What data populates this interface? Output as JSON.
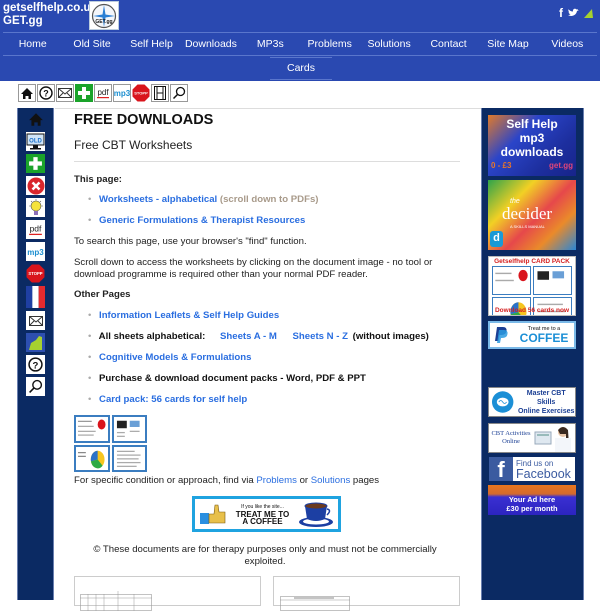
{
  "header": {
    "site_name": "getselfhelp.co.uk",
    "site_short": "GET.gg",
    "logo_text": "GET.gg",
    "social": [
      {
        "name": "facebook",
        "glyph": "f"
      },
      {
        "name": "twitter",
        "glyph": "🐦"
      },
      {
        "name": "getgg",
        "glyph": "▲"
      }
    ],
    "nav": [
      "Home",
      "Old Site",
      "Self Help",
      "Downloads",
      "MP3s",
      "Problems",
      "Solutions",
      "Contact",
      "Site Map",
      "Videos"
    ],
    "nav_row2": [
      "Cards"
    ]
  },
  "toolbar": [
    {
      "name": "home-icon",
      "glyph": "⌂"
    },
    {
      "name": "help-icon",
      "glyph": "?"
    },
    {
      "name": "mail-icon",
      "glyph": "✉"
    },
    {
      "name": "first-aid-icon",
      "glyph": "+"
    },
    {
      "name": "pdf-icon",
      "glyph": "pdf"
    },
    {
      "name": "mp3-icon",
      "glyph": "mp3"
    },
    {
      "name": "stop-icon",
      "glyph": "STOPP"
    },
    {
      "name": "film-icon",
      "glyph": "▥"
    },
    {
      "name": "search-icon",
      "glyph": "⚲"
    }
  ],
  "left_sidebar": [
    {
      "name": "home-icon",
      "glyph": "⌂"
    },
    {
      "name": "old-site-icon",
      "glyph": "OLD"
    },
    {
      "name": "first-aid-icon",
      "glyph": "+"
    },
    {
      "name": "close-icon",
      "glyph": "✕"
    },
    {
      "name": "lightbulb-icon",
      "glyph": "💡"
    },
    {
      "name": "pdf-icon",
      "glyph": "pdf"
    },
    {
      "name": "mp3-icon",
      "glyph": "mp3"
    },
    {
      "name": "stop-icon",
      "glyph": "STOPP"
    },
    {
      "name": "french-flag-icon",
      "glyph": ""
    },
    {
      "name": "mail-icon",
      "glyph": "✉"
    },
    {
      "name": "getgg-icon",
      "glyph": "▲"
    },
    {
      "name": "help-icon",
      "glyph": "?"
    },
    {
      "name": "search-icon",
      "glyph": "⚲"
    }
  ],
  "main": {
    "title": "FREE DOWNLOADS",
    "subtitle": "Free CBT Worksheets",
    "this_page_label": "This page:",
    "this_page_links": [
      {
        "text": "Worksheets - alphabetical",
        "note": "(scroll down to PDFs)"
      },
      {
        "text": "Generic Formulations & Therapist Resources"
      }
    ],
    "search_tip": "To search this page, use your browser's \"find\" function.",
    "scroll_tip": "Scroll down to access the worksheets by clicking on the document image - no tool or download programme is required other than your normal PDF reader.",
    "other_pages_label": "Other Pages",
    "other_pages": {
      "info_leaflets": "Information Leaflets & Self Help Guides",
      "all_sheets_label": "All sheets alphabetical:",
      "sheets_a_m": "Sheets A - M",
      "sheets_n_z": "Sheets N - Z",
      "without_images": "(without images)",
      "cognitive_models": "Cognitive Models & Formulations",
      "purchase": "Purchase & download document packs - Word, PDF & PPT",
      "card_pack": "Card pack: 56 cards for self help"
    },
    "find_via": {
      "prefix": "For specific condition or approach, find via ",
      "problems": "Problems",
      "middle": " or ",
      "solutions": "Solutions",
      "suffix": " pages"
    },
    "coffee_banner": {
      "small": "If you like the site...",
      "line1": "TREAT ME TO",
      "line2": "A COFFEE"
    },
    "copyright": "© These documents are for therapy purposes only and must not be commercially exploited."
  },
  "right_sidebar": {
    "mp3_ad": {
      "line1": "Self Help",
      "line2": "mp3",
      "line3": "downloads",
      "price": "0 - £3",
      "site": "get.gg"
    },
    "decider_ad": {
      "title": "decider",
      "pre": "the",
      "sub": "A SKILLS MANUAL",
      "badge": "d"
    },
    "card_pack_ad": {
      "title": "Getselfhelp CARD PACK",
      "footer": "Download 56 cards now"
    },
    "paypal_ad": {
      "small": "Treat me to a",
      "big": "COFFEE"
    },
    "master_cbt_ad": {
      "line1": "Master CBT Skills",
      "line2": "Online Exercises"
    },
    "cbt_activities_ad": {
      "line1": "CBT Activities",
      "line2": "Online"
    },
    "facebook_ad": {
      "line1": "Find us on",
      "line2": "Facebook"
    },
    "your_ad": {
      "line1": "Your Ad here",
      "line2": "£30 per month"
    }
  }
}
